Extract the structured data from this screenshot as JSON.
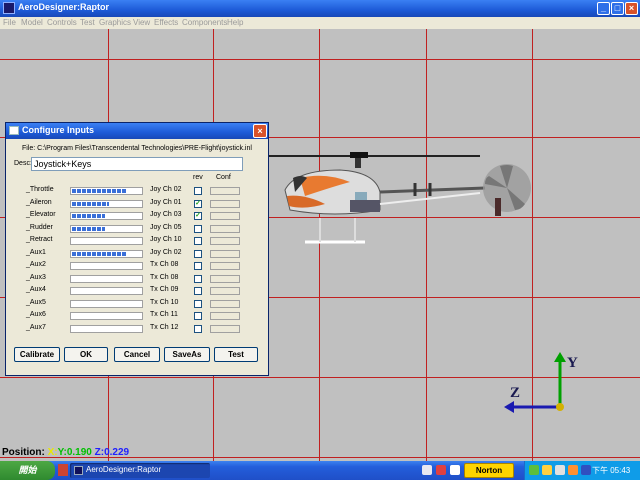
{
  "window": {
    "title": "AeroDesigner:Raptor",
    "min": "_",
    "max": "□",
    "close": "×"
  },
  "menu": [
    "File",
    "Model",
    "Controls",
    "Test",
    "Graphics",
    "View",
    "Effects",
    "Components",
    "Help"
  ],
  "position": {
    "label": "Position:",
    "x": "X:",
    "y": "Y:0.190",
    "z": "Z:0.229"
  },
  "axes": {
    "y_label": "Y",
    "z_label": "Z"
  },
  "dialog": {
    "title": "Configure Inputs",
    "close": "×",
    "file_line": "File: C:\\Program Files\\Transcendental Technologies\\PRE-Flight\\joystick.inl",
    "desc_label": "Desc:",
    "desc_value": "Joystick+Keys",
    "col_rev": "rev",
    "col_conf": "Conf",
    "rows": [
      {
        "label": "_Throttle",
        "fill": 0.78,
        "channel": "Joy Ch 02",
        "rev": false
      },
      {
        "label": "_Aileron",
        "fill": 0.52,
        "channel": "Joy Ch 01",
        "rev": true
      },
      {
        "label": "_Elevator",
        "fill": 0.47,
        "channel": "Joy Ch 03",
        "rev": true
      },
      {
        "label": "_Rudder",
        "fill": 0.47,
        "channel": "Joy Ch 05",
        "rev": false
      },
      {
        "label": "_Retract",
        "fill": 0,
        "channel": "Joy Ch 10",
        "rev": false
      },
      {
        "label": "_Aux1",
        "fill": 0.78,
        "channel": "Joy Ch 02",
        "rev": false
      },
      {
        "label": "_Aux2",
        "fill": 0,
        "channel": "Tx Ch 08",
        "rev": false
      },
      {
        "label": "_Aux3",
        "fill": 0,
        "channel": "Tx Ch 08",
        "rev": false
      },
      {
        "label": "_Aux4",
        "fill": 0,
        "channel": "Tx Ch 09",
        "rev": false
      },
      {
        "label": "_Aux5",
        "fill": 0,
        "channel": "Tx Ch 10",
        "rev": false
      },
      {
        "label": "_Aux6",
        "fill": 0,
        "channel": "Tx Ch 11",
        "rev": false
      },
      {
        "label": "_Aux7",
        "fill": 0,
        "channel": "Tx Ch 12",
        "rev": false
      }
    ],
    "buttons": [
      "Calibrate",
      "OK",
      "Cancel",
      "SaveAs",
      "Test"
    ]
  },
  "taskbar": {
    "start": "開始",
    "app": "AeroDesigner:Raptor",
    "norton": "Norton",
    "clock": "下午 05:43"
  },
  "colors": {
    "grid": "#c02020",
    "accent": "#245edb",
    "axis_y": "#00a000",
    "axis_z": "#1a1ab0"
  }
}
